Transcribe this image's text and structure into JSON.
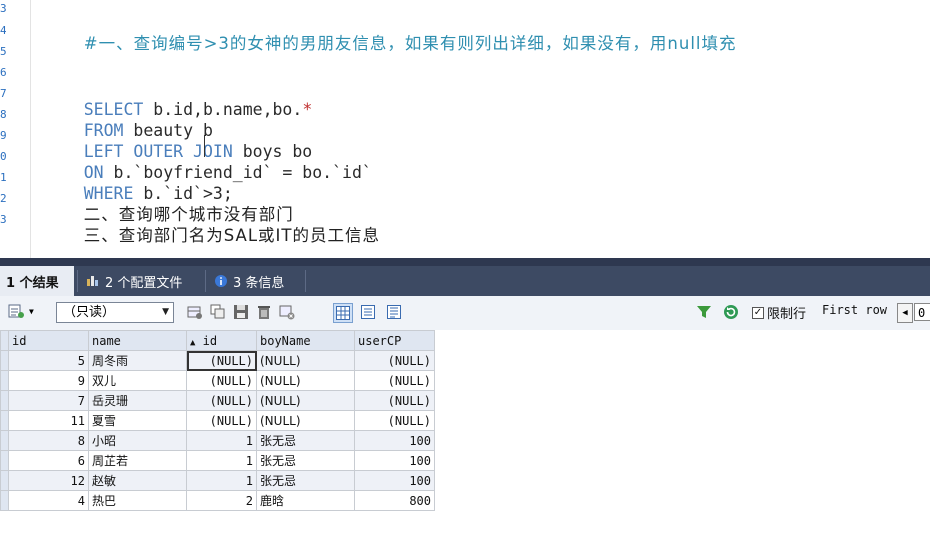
{
  "editor": {
    "line_numbers": [
      "3",
      "4",
      "5",
      "6",
      "7",
      "8",
      "9",
      "0",
      "1",
      "2",
      "3"
    ],
    "comment": "#一、查询编号>3的女神的男朋友信息，如果有则列出详细，如果没有，用null填充",
    "sql": {
      "select_kw": "SELECT",
      "select_cols": " b.id,b.name,bo.",
      "star": "*",
      "from_kw": "FROM",
      "from_rest": " beauty b",
      "join_kw": "LEFT OUTER JOIN",
      "join_rest": " boys bo",
      "on_kw": "ON",
      "on_rest": " b.`boyfriend_id` = bo.`id`",
      "where_kw": "WHERE",
      "where_rest": " b.`id`>3;"
    },
    "note_2": "二、查询哪个城市没有部门",
    "note_3": "三、查询部门名为SAL或IT的员工信息"
  },
  "tabs": [
    {
      "label": "1 个结果",
      "icon": "grid-icon"
    },
    {
      "label": "2 个配置文件",
      "icon": "profile-icon"
    },
    {
      "label": "3 条信息",
      "icon": "info-icon"
    }
  ],
  "toolbar": {
    "readonly_value": "（只读）",
    "limit_label": "限制行",
    "first_row_label": "First row",
    "first_row_value": "0"
  },
  "grid": {
    "columns": [
      "id",
      "name",
      "id",
      "boyName",
      "userCP"
    ],
    "sorted_column_indicator": "▲",
    "rows": [
      [
        "5",
        "周冬雨",
        "(NULL)",
        "(NULL)",
        "(NULL)"
      ],
      [
        "9",
        "双儿",
        "(NULL)",
        "(NULL)",
        "(NULL)"
      ],
      [
        "7",
        "岳灵珊",
        "(NULL)",
        "(NULL)",
        "(NULL)"
      ],
      [
        "11",
        "夏雪",
        "(NULL)",
        "(NULL)",
        "(NULL)"
      ],
      [
        "8",
        "小昭",
        "1",
        "张无忌",
        "100"
      ],
      [
        "6",
        "周芷若",
        "1",
        "张无忌",
        "100"
      ],
      [
        "12",
        "赵敏",
        "1",
        "张无忌",
        "100"
      ],
      [
        "4",
        "热巴",
        "2",
        "鹿晗",
        "800"
      ]
    ]
  },
  "colors": {
    "keyword": "#4a7ebb",
    "comment": "#2f8fb0",
    "tab_bar": "#3d4a63",
    "header_bg": "#dfe6f1"
  }
}
